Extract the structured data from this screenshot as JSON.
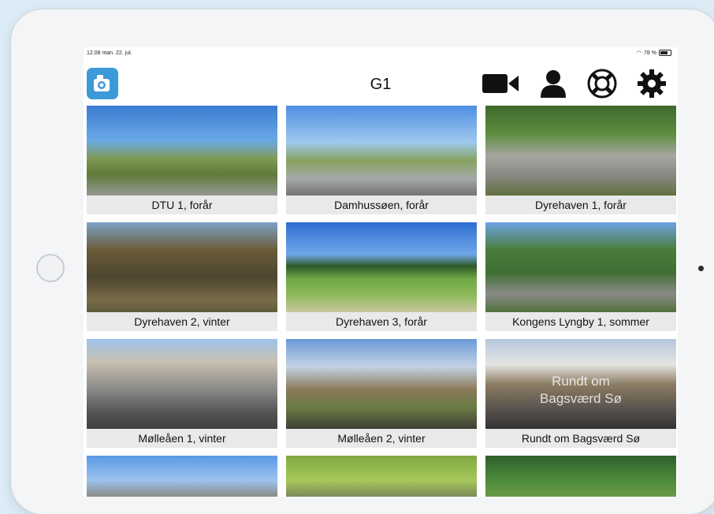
{
  "status": {
    "time": "12.08  man. 22. jul.",
    "battery": "78 %"
  },
  "nav": {
    "title": "G1"
  },
  "icons": [
    "video-camera-icon",
    "user-icon",
    "lifebuoy-icon",
    "gear-icon"
  ],
  "videos": [
    {
      "title": "DTU 1, forår"
    },
    {
      "title": "Damhussøen, forår"
    },
    {
      "title": "Dyrehaven 1, forår"
    },
    {
      "title": "Dyrehaven 2, vinter"
    },
    {
      "title": "Dyrehaven 3, forår"
    },
    {
      "title": "Kongens Lyngby 1, sommer"
    },
    {
      "title": "Mølleåen 1, vinter"
    },
    {
      "title": "Mølleåen 2, vinter"
    },
    {
      "title": "Rundt om Bagsværd Sø",
      "overlay": [
        "Rundt om",
        "Bagsværd Sø"
      ]
    }
  ],
  "colors": {
    "accent": "#3d9ad9",
    "caption_bg": "#e9e9e9"
  }
}
